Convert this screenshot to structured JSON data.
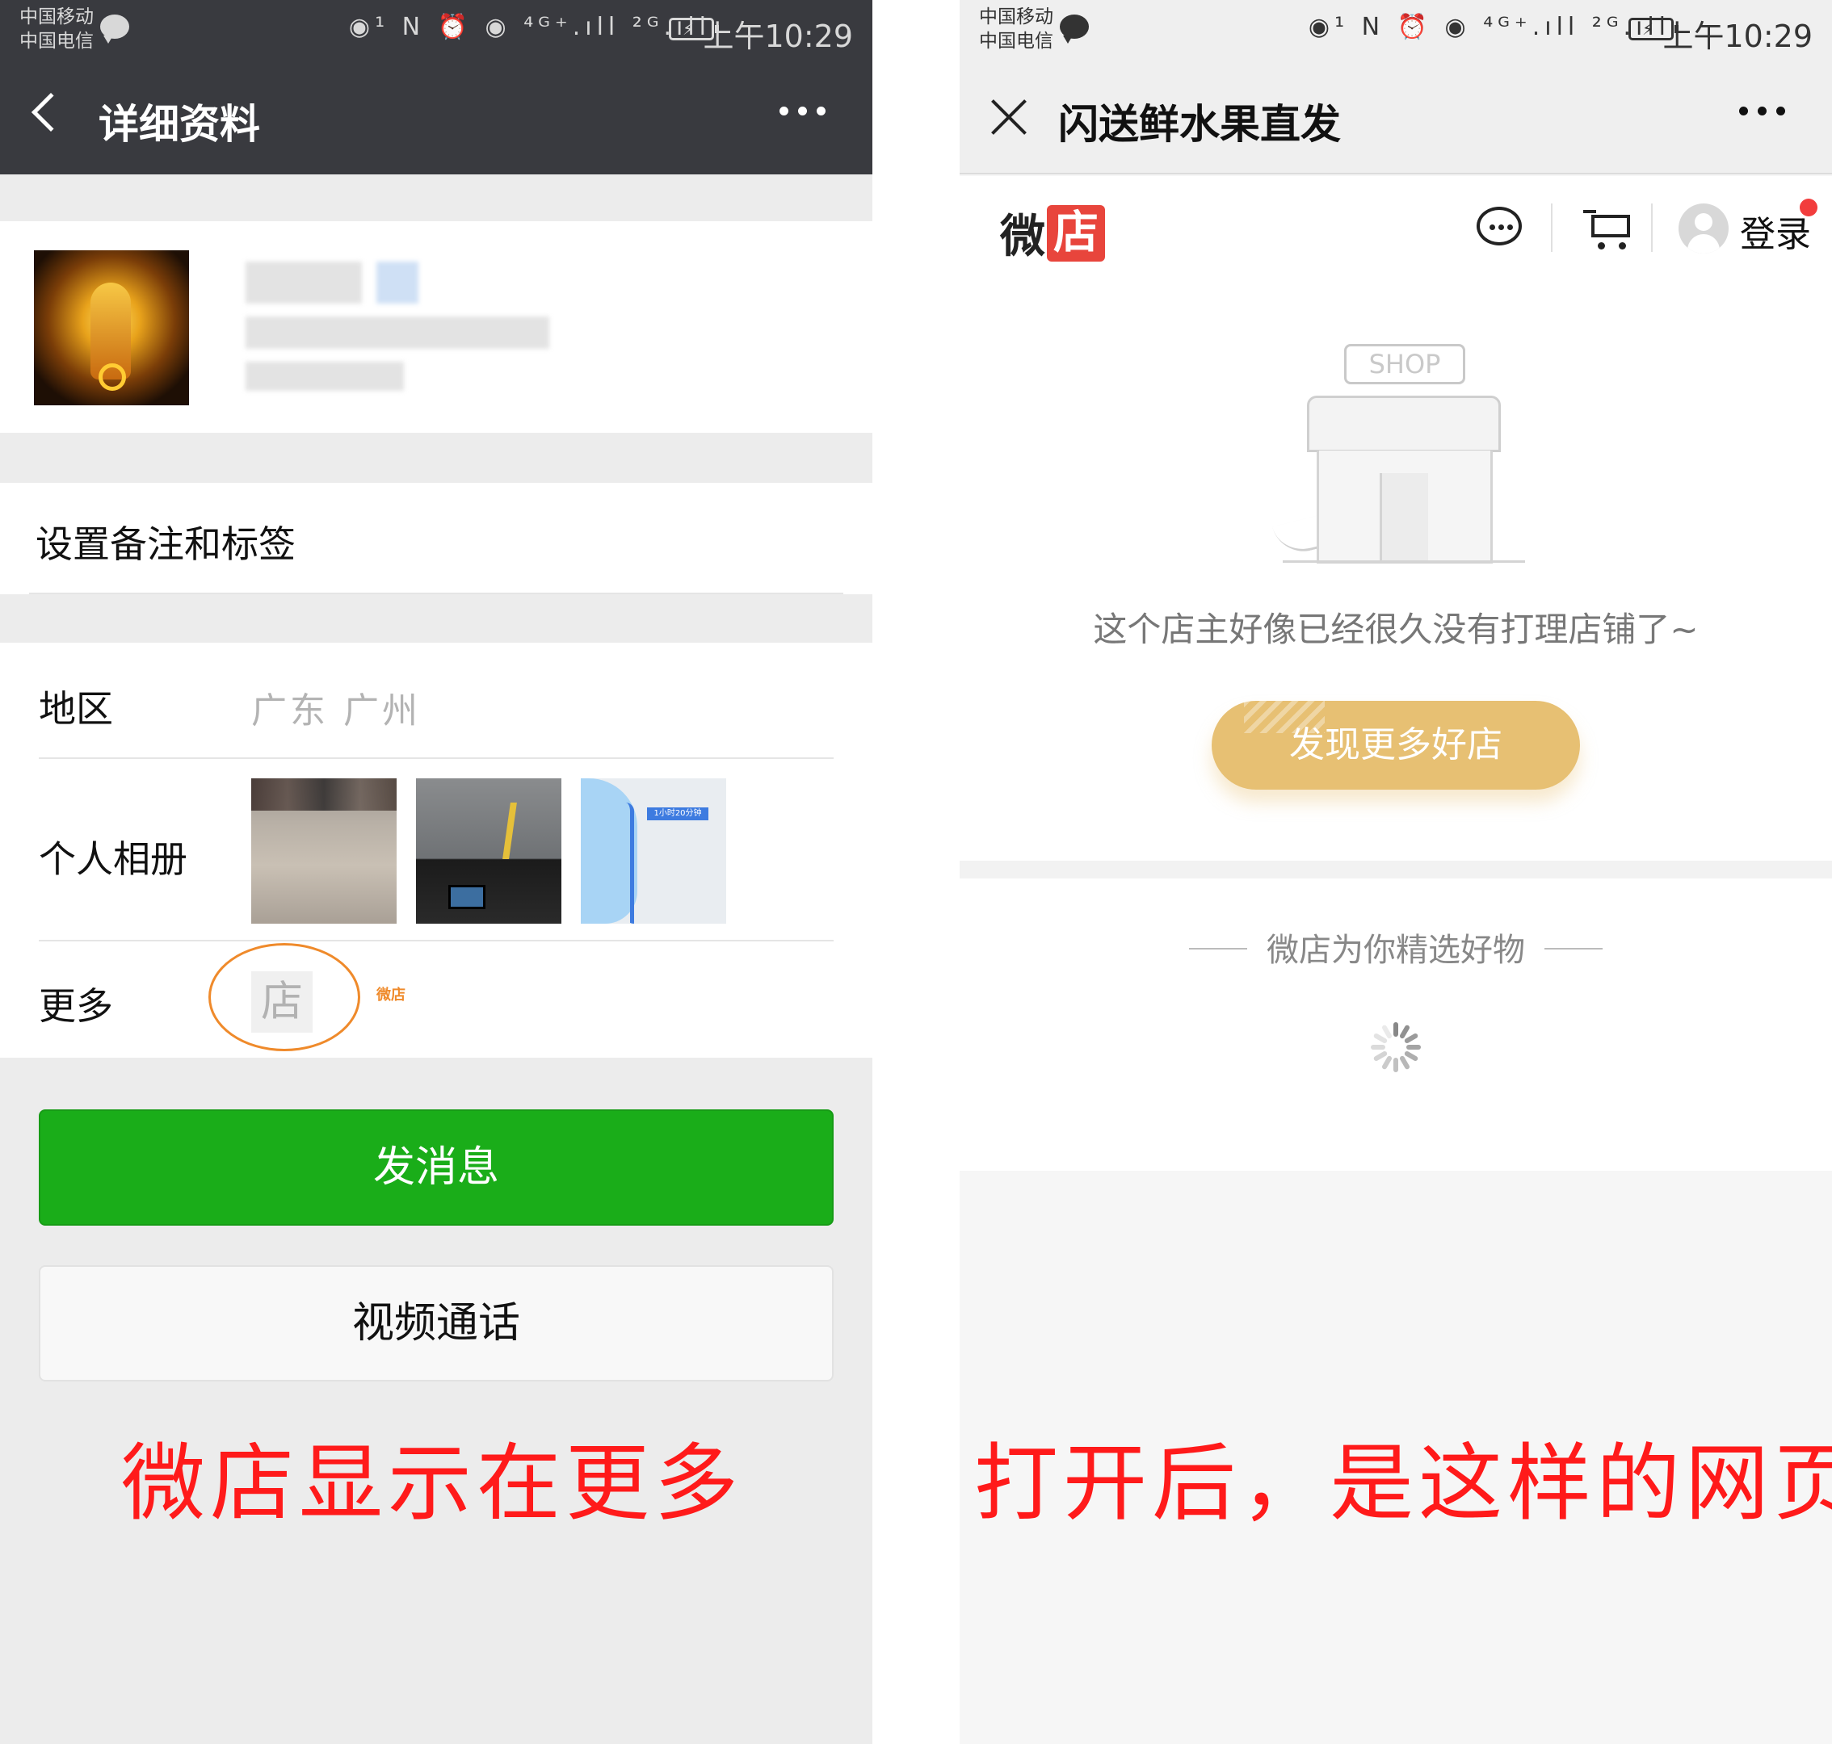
{
  "left": {
    "status": {
      "carrier1": "中国移动",
      "carrier2": "中国电信",
      "icons": "◉¹ N ⏰ ◉ ⁴ᴳ⁺.ıll ²ᴳ.ıll",
      "time": "上午10:29"
    },
    "header": {
      "title": "详细资料"
    },
    "menu": {
      "remark": "设置备注和标签"
    },
    "region": {
      "label": "地区",
      "value": "广东  广州"
    },
    "album": {
      "label": "个人相册",
      "photo3_tag": "1小时20分钟"
    },
    "more": {
      "label": "更多",
      "shop_icon_text": "店",
      "shop_label": "微店"
    },
    "buttons": {
      "message": "发消息",
      "video_call": "视频通话"
    },
    "caption": "微店显示在更多"
  },
  "right": {
    "status": {
      "carrier1": "中国移动",
      "carrier2": "中国电信",
      "icons": "◉¹ N ⏰ ◉ ⁴ᴳ⁺.ıll ²ᴳ.ıll",
      "time": "上午10:29"
    },
    "header": {
      "title": "闪送鲜水果直发"
    },
    "weidian": {
      "logo_a": "微",
      "logo_b": "店",
      "login": "登录"
    },
    "empty": {
      "sign": "SHOP",
      "message": "这个店主好像已经很久没有打理店铺了~",
      "button": "发现更多好店"
    },
    "picks": {
      "title": "微店为你精选好物"
    },
    "caption": "打开后，是这样的网页"
  },
  "colors": {
    "wechat_green": "#1aad19",
    "dark_header": "#393a3f",
    "gold": "#e7c073",
    "annotation_red": "#ff1a1a",
    "circle_orange": "#ef8a2b"
  }
}
